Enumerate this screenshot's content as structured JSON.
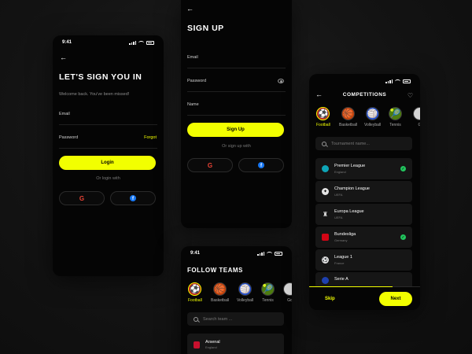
{
  "colors": {
    "accent": "#f2ff00",
    "background": "#050505",
    "card": "#161616",
    "check": "#22c55e"
  },
  "signin": {
    "time": "9:41",
    "title": "LET'S SIGN YOU IN",
    "subtitle": "Welcome back. You've been missed!",
    "email_label": "Email",
    "password_label": "Password",
    "forgot_label": "Forgot",
    "login_label": "Login",
    "or_text": "Or login with",
    "social": [
      "google-icon",
      "facebook-icon"
    ]
  },
  "signup": {
    "title": "SIGN UP",
    "email_label": "Email",
    "password_label": "Password",
    "name_label": "Name",
    "signup_label": "Sign Up",
    "or_text": "Or sign up with",
    "social": [
      "google-icon",
      "facebook-icon"
    ]
  },
  "follow": {
    "time": "9:41",
    "title": "FOLLOW TEAMS",
    "sports": [
      {
        "label": "Football",
        "icon": "⚽",
        "selected": true
      },
      {
        "label": "Basketball",
        "icon": "🏀",
        "selected": false
      },
      {
        "label": "Volleyball",
        "icon": "🏐",
        "selected": false
      },
      {
        "label": "Tennis",
        "icon": "🎾",
        "selected": false
      },
      {
        "label": "Go",
        "icon": "",
        "selected": false
      }
    ],
    "search_placeholder": "Search team ...",
    "teams": [
      {
        "name": "Arsenal",
        "sub": "England"
      }
    ]
  },
  "competitions": {
    "title": "COMPETITIONS",
    "sports": [
      {
        "label": "Football",
        "icon": "⚽",
        "selected": true
      },
      {
        "label": "Basketball",
        "icon": "🏀",
        "selected": false
      },
      {
        "label": "Volleyball",
        "icon": "🏐",
        "selected": false
      },
      {
        "label": "Tennis",
        "icon": "🎾",
        "selected": false
      },
      {
        "label": "G",
        "icon": "",
        "selected": false
      }
    ],
    "search_placeholder": "Tournament name...",
    "leagues": [
      {
        "name": "Premier League",
        "sub": "England",
        "checked": true
      },
      {
        "name": "Champion League",
        "sub": "UEFA",
        "checked": false
      },
      {
        "name": "Europa League",
        "sub": "UEFA",
        "checked": false
      },
      {
        "name": "Bundesliga",
        "sub": "Germany",
        "checked": true
      },
      {
        "name": "League 1",
        "sub": "France",
        "checked": false
      },
      {
        "name": "Serie A",
        "sub": "",
        "checked": false
      }
    ],
    "skip_label": "Skip",
    "next_label": "Next"
  }
}
